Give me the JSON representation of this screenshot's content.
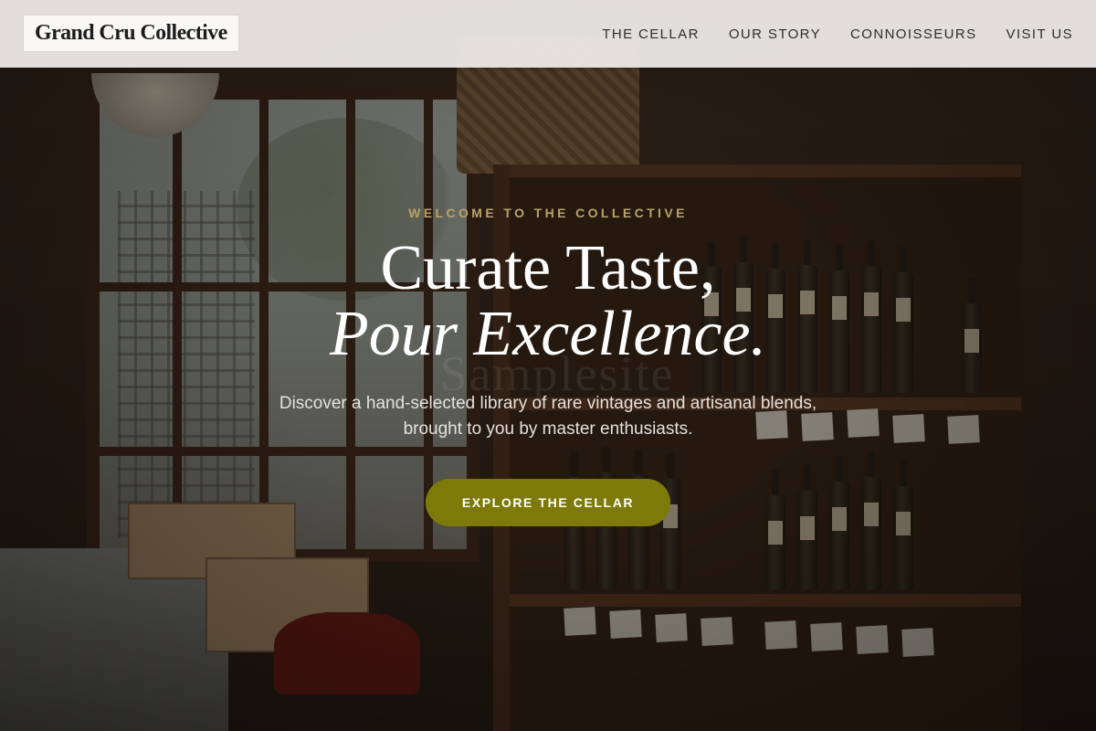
{
  "navbar": {
    "brand": "Grand Cru Collective",
    "links": [
      "THE CELLAR",
      "OUR STORY",
      "CONNOISSEURS",
      "VISIT US"
    ]
  },
  "hero": {
    "eyebrow": "WELCOME TO THE COLLECTIVE",
    "headline_line1": "Curate Taste,",
    "headline_line2": "Pour Excellence.",
    "subtext": "Discover a hand-selected library of rare vintages and artisanal blends, brought to you by master enthusiasts.",
    "cta_label": "EXPLORE THE CELLAR",
    "watermark": "Samplesite"
  },
  "colors": {
    "accent": "#7d7a09",
    "eyebrow": "#b8a36a",
    "navbar_bg": "#f0eeeb",
    "heading": "#ffffff"
  }
}
